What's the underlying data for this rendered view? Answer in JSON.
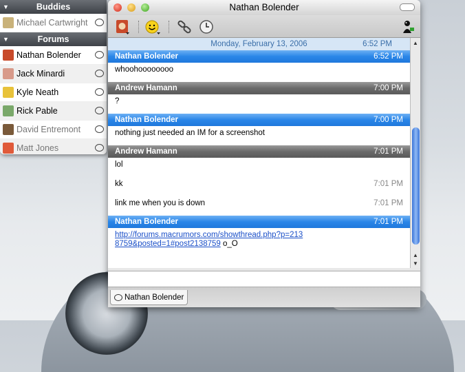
{
  "buddylist": {
    "buddies_header": "Buddies",
    "buddies": [
      {
        "name": "Michael Cartwright",
        "idle": true,
        "color": "#c9b27a"
      }
    ],
    "forums_header": "Forums",
    "forums": [
      {
        "name": "Nathan Bolender",
        "idle": false,
        "color": "#c84a2a"
      },
      {
        "name": "Jack Minardi",
        "idle": false,
        "color": "#d89a8a"
      },
      {
        "name": "Kyle Neath",
        "idle": false,
        "color": "#e8c23a"
      },
      {
        "name": "Rick Pable",
        "idle": false,
        "color": "#7aa86a"
      },
      {
        "name": "David Entremont",
        "idle": true,
        "color": "#7a5a3a"
      },
      {
        "name": "Matt Jones",
        "idle": true,
        "color": "#e05a3a"
      }
    ]
  },
  "chat": {
    "title": "Nathan Bolender",
    "date_line": {
      "date": "Monday, February 13, 2006",
      "time": "6:52 PM"
    },
    "blocks": [
      {
        "sender": "Nathan Bolender",
        "time": "6:52 PM",
        "style": "blue",
        "lines": [
          {
            "text": "whoohoooooooo",
            "time": ""
          }
        ]
      },
      {
        "sender": "Andrew Hamann",
        "time": "7:00 PM",
        "style": "gray",
        "lines": [
          {
            "text": "?",
            "time": ""
          }
        ]
      },
      {
        "sender": "Nathan Bolender",
        "time": "7:00 PM",
        "style": "blue",
        "lines": [
          {
            "text": "nothing just needed an IM for a screenshot",
            "time": ""
          }
        ]
      },
      {
        "sender": "Andrew Hamann",
        "time": "7:01 PM",
        "style": "gray",
        "lines": [
          {
            "text": "lol",
            "time": ""
          },
          {
            "text": "kk",
            "time": "7:01 PM"
          },
          {
            "text": "link me when you is down",
            "time": "7:01 PM"
          }
        ]
      },
      {
        "sender": "Nathan Bolender",
        "time": "7:01 PM",
        "style": "blue",
        "lines": [
          {
            "link": "http://forums.macrumors.com/showthread.php?p=2138759&posted=1#post2138759",
            "text": " o_O",
            "time": ""
          }
        ]
      }
    ],
    "tab_label": "Nathan Bolender"
  }
}
